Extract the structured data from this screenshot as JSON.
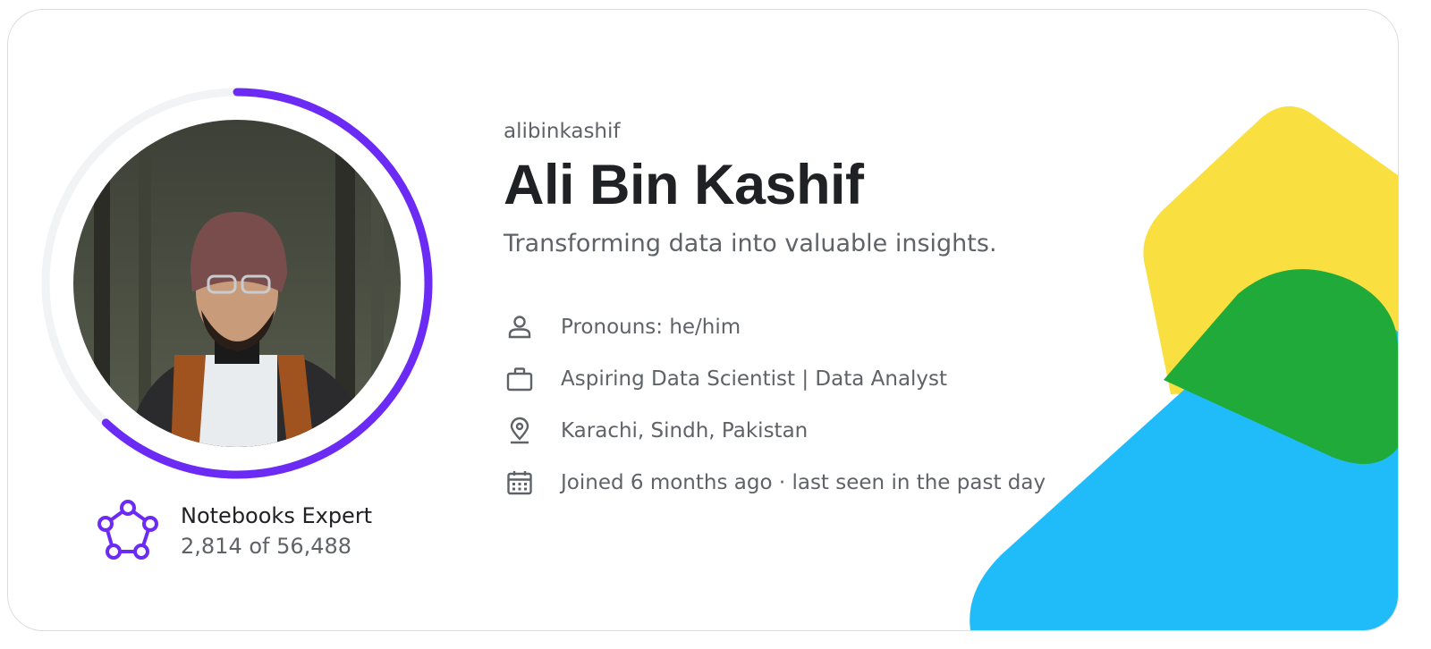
{
  "profile": {
    "username": "alibinkashif",
    "full_name": "Ali Bin Kashif",
    "tagline": "Transforming data into valuable insights.",
    "avatar_alt": "Profile photo",
    "progress_fraction": 0.62
  },
  "tier": {
    "title": "Notebooks Expert",
    "rank": "2,814 of 56,488"
  },
  "details": [
    {
      "icon": "person-icon",
      "text": "Pronouns: he/him"
    },
    {
      "icon": "briefcase-icon",
      "text": "Aspiring Data Scientist | Data Analyst"
    },
    {
      "icon": "location-pin-icon",
      "text": "Karachi, Sindh, Pakistan"
    },
    {
      "icon": "calendar-icon",
      "text": "Joined 6 months ago · last seen in the past day"
    }
  ],
  "colors": {
    "progress": "#6c2bf5",
    "track": "#f1f3f4",
    "shape_yellow": "#f9df3f",
    "shape_green": "#1faa3a",
    "shape_blue": "#20bcfa",
    "icon_gray": "#5f6368"
  }
}
